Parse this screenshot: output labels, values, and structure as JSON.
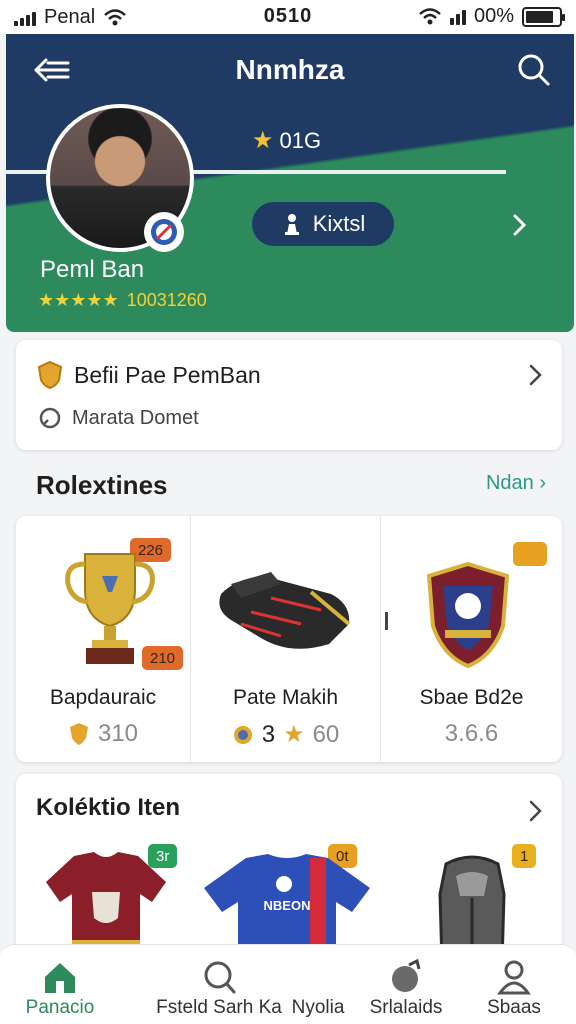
{
  "status_bar": {
    "carrier": "Penal",
    "time": "0510",
    "battery_text": "00%",
    "battery_level": 0.85
  },
  "header": {
    "title": "Nnmhza",
    "rating": "01G",
    "pill_label": "Kixtsl",
    "player_name": "Peml Ban",
    "stars": "★★★★★",
    "stats_number": "10031260"
  },
  "profile_card": {
    "title": "Befii Pae PemBan",
    "subtitle": "Marata Domet"
  },
  "relics_section": {
    "title": "Rolextines",
    "see_all": "Ndan",
    "items": [
      {
        "name": "Bapdauraic",
        "value": "310",
        "tag_top": "226",
        "tag_bottom": "210",
        "tag_color": "#e06a2a"
      },
      {
        "name": "Pate Makih",
        "value": "60",
        "value_prefix": "3",
        "tag_top": "",
        "tag_color": "#e0a22a"
      },
      {
        "name": "Sbae Bd2e",
        "value": "3.6.6",
        "tag_top": "",
        "tag_color": "#e8a020"
      }
    ]
  },
  "collection": {
    "title": "Koléktio Iten",
    "items": [
      {
        "tag": "3r",
        "tag_color": "#2aa15a"
      },
      {
        "tag": "0t",
        "tag_color": "#e8a020"
      },
      {
        "tag": "1",
        "tag_color": "#e8b020"
      }
    ],
    "jersey_text": "NBEON"
  },
  "bottom_nav": {
    "items": [
      {
        "label": "Panacio",
        "icon": "home-icon"
      },
      {
        "label": "Fsteld Sarh Ka",
        "icon": "search-icon"
      },
      {
        "label": "Nyolia",
        "icon": ""
      },
      {
        "label": "Srlalaids",
        "icon": "bag-icon"
      },
      {
        "label": "Sbaas",
        "icon": "user-icon"
      }
    ]
  },
  "colors": {
    "navy": "#1f3a63",
    "green": "#2d8a5c",
    "accent": "#2a9a86",
    "gold": "#f2c230"
  }
}
